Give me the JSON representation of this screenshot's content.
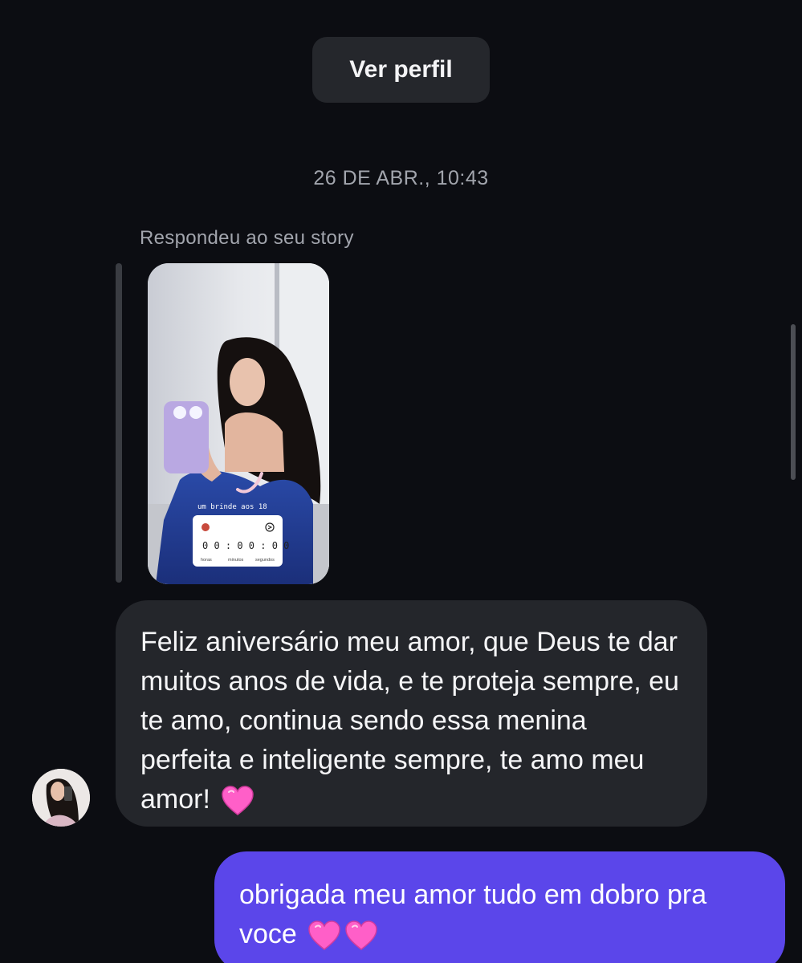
{
  "header": {
    "view_profile_label": "Ver perfil"
  },
  "thread": {
    "timestamp": "26 DE ABR., 10:43",
    "reply_label": "Respondeu ao seu story",
    "story": {
      "caption": "um brinde aos 18",
      "countdown": "0 0 : 0 0 : 0 0",
      "unit_hours": "horas",
      "unit_minutes": "minutos",
      "unit_seconds": "segundos"
    },
    "incoming_message": "Feliz aniversário meu amor, que Deus te dar muitos anos de vida, e te proteja sempre, eu te amo, continua sendo essa menina perfeita e inteligente sempre, te amo meu amor!",
    "outgoing_message": "obrigada meu amor tudo em dobro pra voce"
  },
  "icons": {
    "heart_emoji": "pink-heart-icon"
  },
  "colors": {
    "background": "#0c0d12",
    "incoming_bubble": "#24262b",
    "outgoing_bubble": "#5b46ea",
    "heart": "#ff5fc8"
  }
}
